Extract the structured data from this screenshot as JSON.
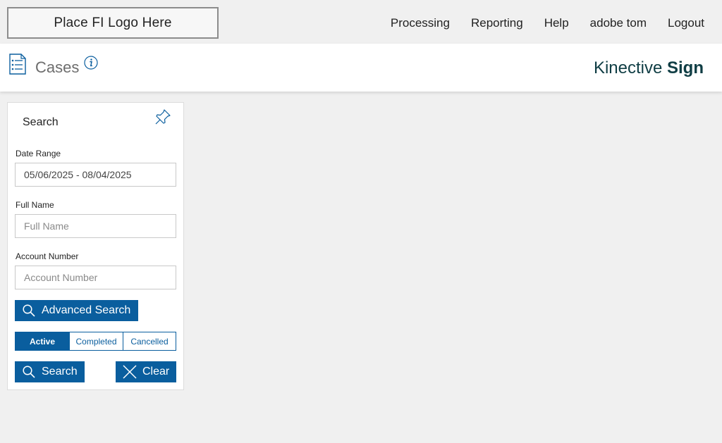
{
  "topbar": {
    "logo_text": "Place FI Logo Here",
    "nav": [
      "Processing",
      "Reporting",
      "Help",
      "adobe tom",
      "Logout"
    ]
  },
  "header": {
    "title": "Cases",
    "brand_light": "Kinective ",
    "brand_bold": "Sign",
    "icons": {
      "cases": "list-icon",
      "info": "info-icon"
    }
  },
  "search_panel": {
    "title": "Search",
    "pin_icon": "pin-icon",
    "date_range": {
      "label": "Date Range",
      "value": "05/06/2025 - 08/04/2025"
    },
    "full_name": {
      "label": "Full Name",
      "placeholder": "Full Name",
      "value": ""
    },
    "account_number": {
      "label": "Account Number",
      "placeholder": "Account Number",
      "value": ""
    },
    "advanced_search_label": "Advanced Search",
    "status_tabs": [
      "Active",
      "Completed",
      "Cancelled"
    ],
    "selected_status": "Active",
    "search_label": "Search",
    "clear_label": "Clear"
  },
  "colors": {
    "primary": "#0a5e9e",
    "brand": "#0f3d44",
    "background": "#f0f0f0"
  }
}
